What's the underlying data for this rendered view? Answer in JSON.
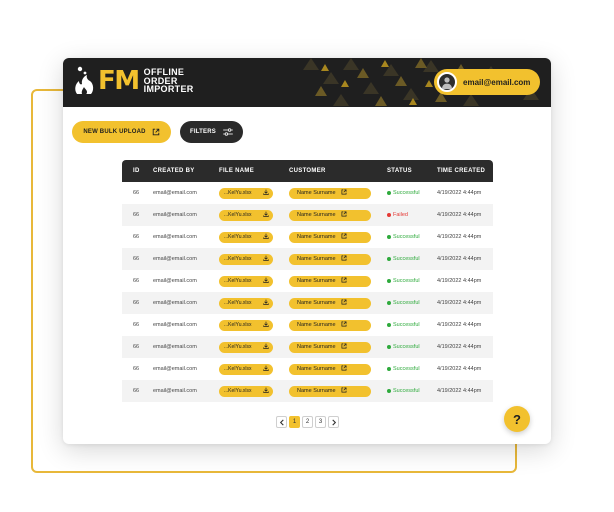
{
  "app": {
    "logo_mark": "FM",
    "logo_lines": [
      "OFFLINE",
      "ORDER",
      "IMPORTER"
    ],
    "account_email": "email@email.com"
  },
  "toolbar": {
    "new_bulk_upload_label": "NEW BULK UPLOAD",
    "filters_label": "FILTERS"
  },
  "table": {
    "columns": [
      "ID",
      "CREATED BY",
      "FILE NAME",
      "CUSTOMER",
      "STATUS",
      "TIME CREATED"
    ],
    "rows": [
      {
        "id": "66",
        "created_by": "email@email.com",
        "file": "...KeIYu.xlsx",
        "customer": "Name Surname",
        "status": "Successful",
        "time": "4/19/2022 4:44pm"
      },
      {
        "id": "66",
        "created_by": "email@email.com",
        "file": "...KeIYu.xlsx",
        "customer": "Name Surname",
        "status": "Failed",
        "time": "4/19/2022 4:44pm"
      },
      {
        "id": "66",
        "created_by": "email@email.com",
        "file": "...KeIYu.xlsx",
        "customer": "Name Surname",
        "status": "Successful",
        "time": "4/19/2022 4:44pm"
      },
      {
        "id": "66",
        "created_by": "email@email.com",
        "file": "...KeIYu.xlsx",
        "customer": "Name Surname",
        "status": "Successful",
        "time": "4/19/2022 4:44pm"
      },
      {
        "id": "66",
        "created_by": "email@email.com",
        "file": "...KeIYu.xlsx",
        "customer": "Name Surname",
        "status": "Successful",
        "time": "4/19/2022 4:44pm"
      },
      {
        "id": "66",
        "created_by": "email@email.com",
        "file": "...KeIYu.xlsx",
        "customer": "Name Surname",
        "status": "Successful",
        "time": "4/19/2022 4:44pm"
      },
      {
        "id": "66",
        "created_by": "email@email.com",
        "file": "...KeIYu.xlsx",
        "customer": "Name Surname",
        "status": "Successful",
        "time": "4/19/2022 4:44pm"
      },
      {
        "id": "66",
        "created_by": "email@email.com",
        "file": "...KeIYu.xlsx",
        "customer": "Name Surname",
        "status": "Successful",
        "time": "4/19/2022 4:44pm"
      },
      {
        "id": "66",
        "created_by": "email@email.com",
        "file": "...KeIYu.xlsx",
        "customer": "Name Surname",
        "status": "Successful",
        "time": "4/19/2022 4:44pm"
      },
      {
        "id": "66",
        "created_by": "email@email.com",
        "file": "...KeIYu.xlsx",
        "customer": "Name Surname",
        "status": "Successful",
        "time": "4/19/2022 4:44pm"
      }
    ]
  },
  "pagination": {
    "prev_icon": "chevron-left-icon",
    "pages": [
      "1",
      "2",
      "3"
    ],
    "current_page": "1",
    "next_icon": "chevron-right-icon"
  },
  "help": {
    "label": "?"
  },
  "icons": {
    "upload": "external-link-icon",
    "filters": "sliders-icon",
    "file": "download-icon",
    "customer": "external-link-icon",
    "avatar": "user-avatar-icon"
  },
  "colors": {
    "accent": "#F2C12E",
    "dark": "#1f1f1f",
    "success": "#2eaa3c",
    "failed": "#e53935",
    "outline": "#E8B83A"
  }
}
